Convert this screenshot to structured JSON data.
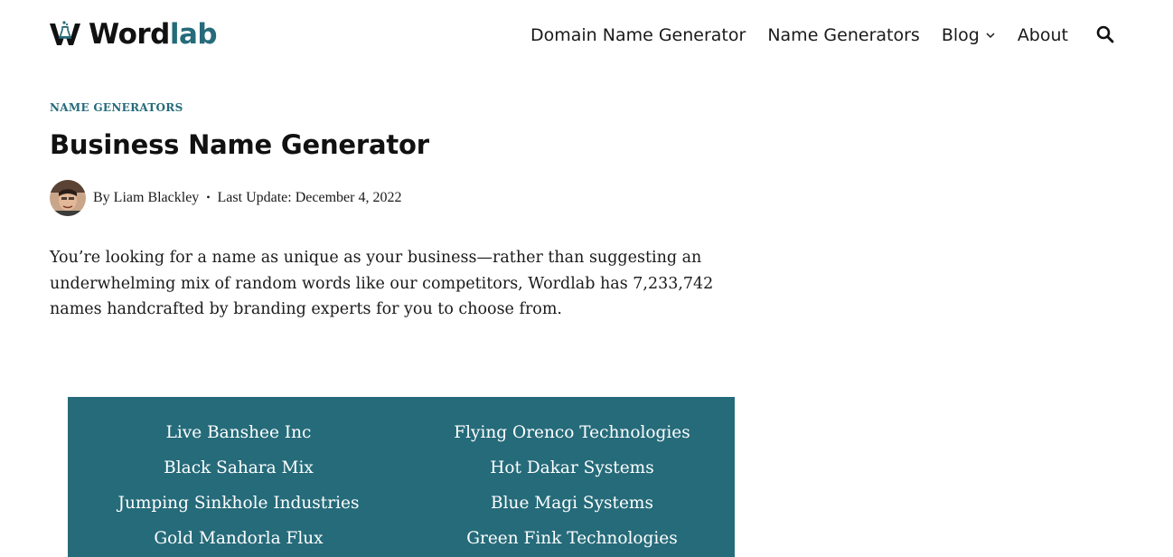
{
  "header": {
    "logo": {
      "word": "Word",
      "accent": "lab"
    },
    "nav": [
      {
        "label": "Domain Name Generator",
        "has_dropdown": false
      },
      {
        "label": "Name Generators",
        "has_dropdown": false
      },
      {
        "label": "Blog",
        "has_dropdown": true
      },
      {
        "label": "About",
        "has_dropdown": false
      }
    ],
    "search_icon": "search-icon"
  },
  "article": {
    "category": "NAME GENERATORS",
    "title": "Business Name Generator",
    "meta": {
      "by": "By",
      "author": "Liam Blackley",
      "separator": "•",
      "last_update": "Last Update: December 4, 2022"
    },
    "intro": "You’re looking for a name as unique as your business—rather than suggesting an underwhelming mix of random words like our competitors, Wordlab has 7,233,742 names handcrafted by branding experts for you to choose from."
  },
  "names": [
    "Live Banshee Inc",
    "Flying Orenco Technologies",
    "Black Sahara Mix",
    "Hot Dakar Systems",
    "Jumping Sinkhole Industries",
    "Blue Magi Systems",
    "Gold Mandorla Flux",
    "Green Fink Technologies"
  ],
  "colors": {
    "accent": "#256b7a",
    "panel_bg": "#256b7a",
    "text": "#1a1a1a",
    "panel_text": "#ffffff"
  }
}
